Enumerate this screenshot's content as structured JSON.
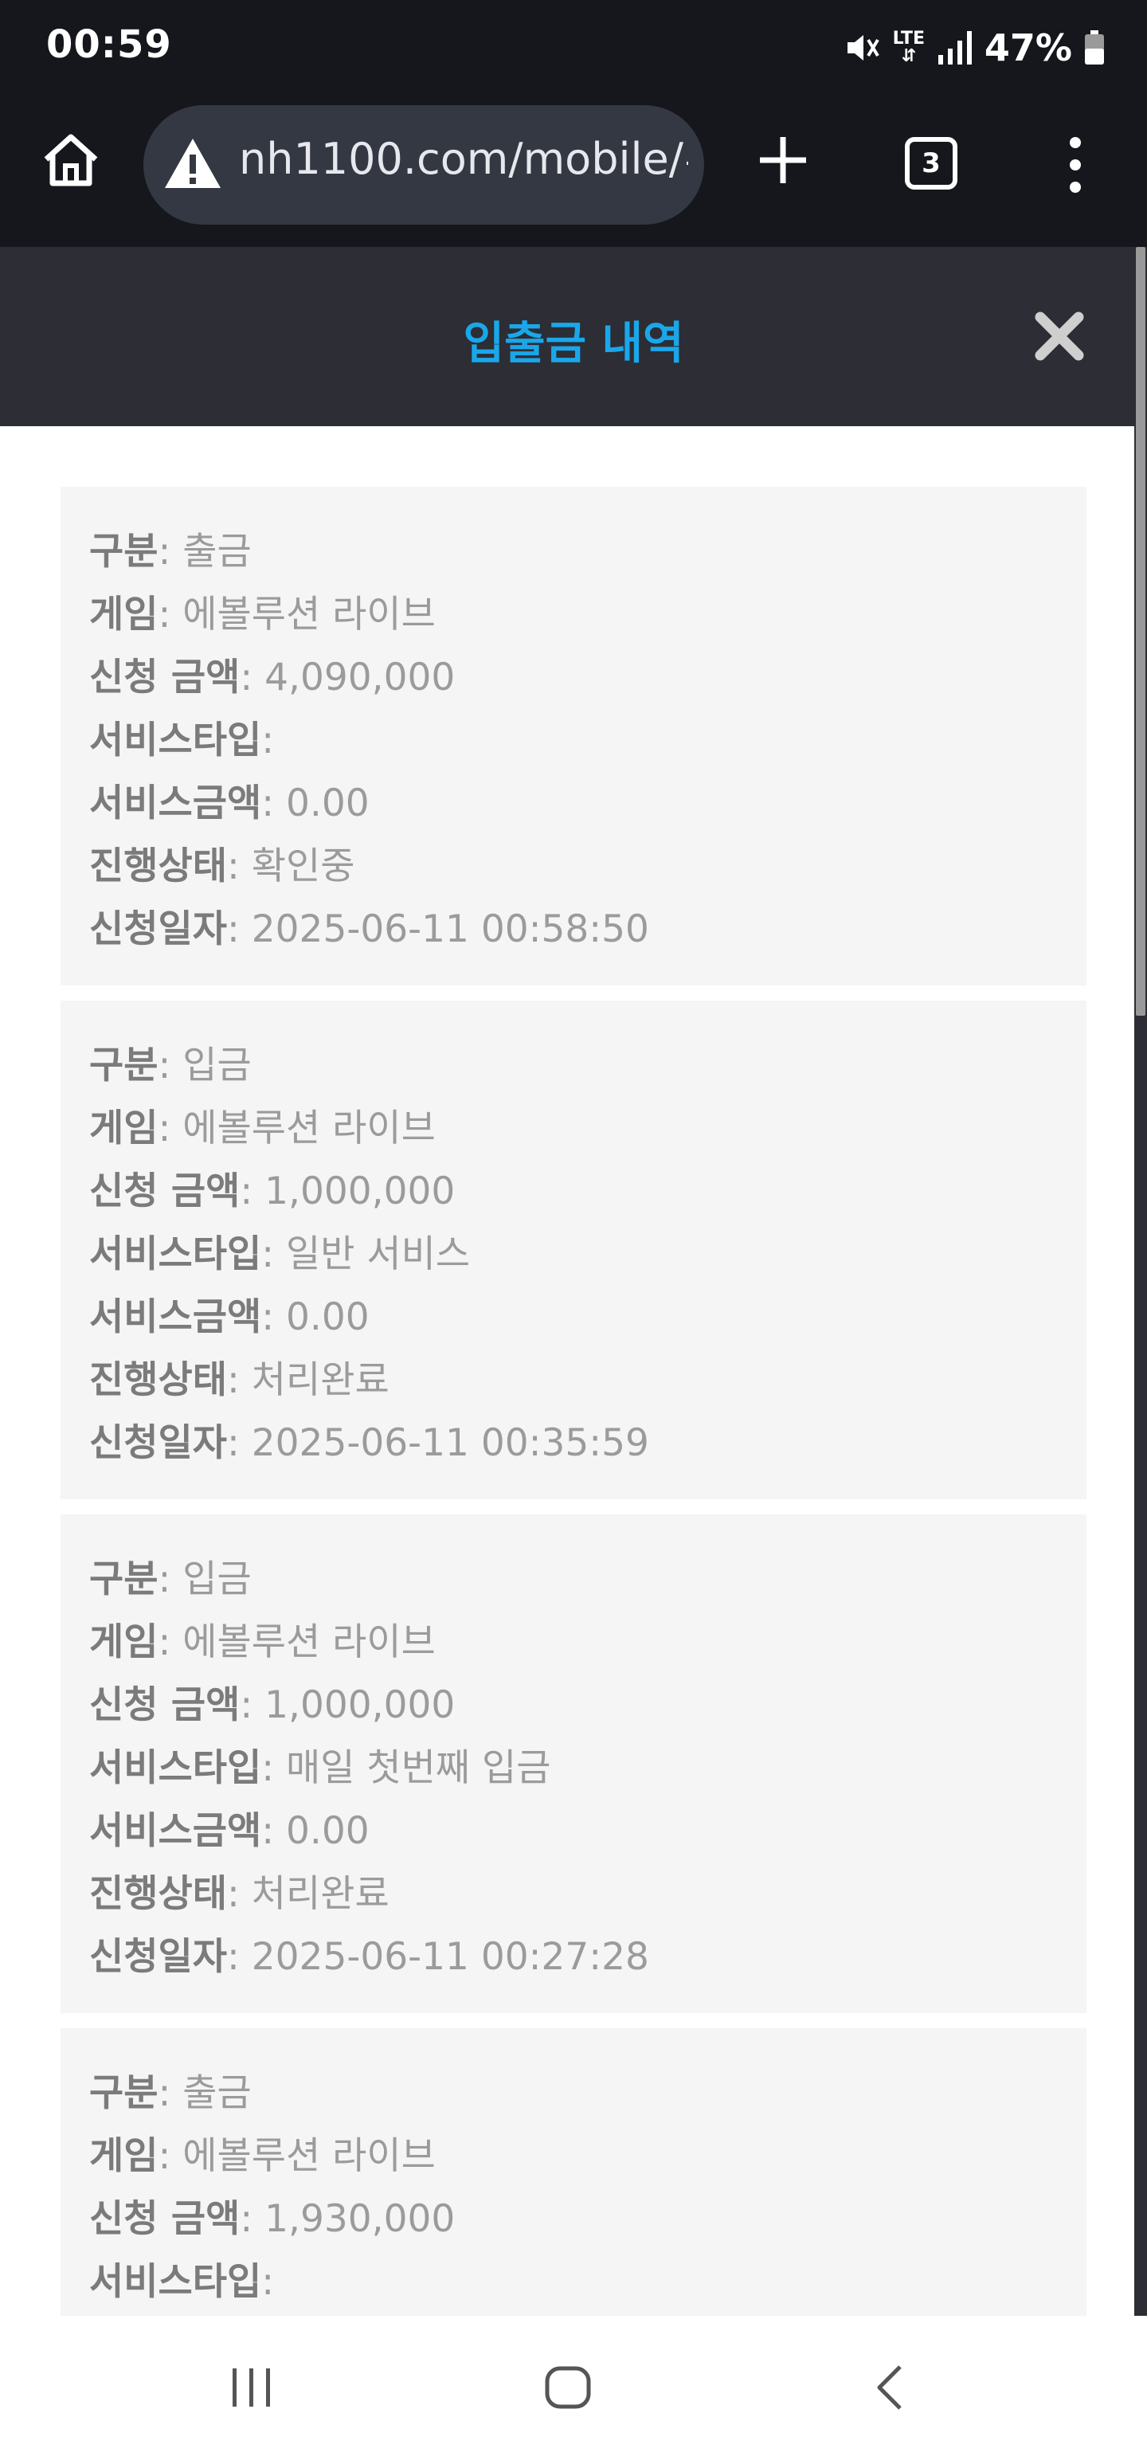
{
  "status_bar": {
    "time": "00:59",
    "network": "LTE",
    "battery": "47%",
    "icons": [
      "mute-icon",
      "lte-icon",
      "signal-icon",
      "battery-icon"
    ]
  },
  "browser": {
    "url": "nh1100.com/mobile/#",
    "tab_count": "3",
    "icons": [
      "home-icon",
      "warning-icon",
      "plus-icon",
      "tabs-icon",
      "more-vert-icon"
    ]
  },
  "page": {
    "title": "입출금 내역",
    "close_icon": "close-icon"
  },
  "labels": {
    "type": "구분",
    "game": "게임",
    "amount": "신청 금액",
    "service_type": "서비스타입",
    "service_amount": "서비스금액",
    "status": "진행상태",
    "date": "신청일자"
  },
  "records": [
    {
      "type": ": 출금",
      "game": ": 에볼루션 라이브",
      "amount": ": 4,090,000",
      "service_type": ":",
      "service_amount": ": 0.00",
      "status": ": 확인중",
      "date": ": 2025-06-11 00:58:50"
    },
    {
      "type": ": 입금",
      "game": ": 에볼루션 라이브",
      "amount": ": 1,000,000",
      "service_type": ": 일반 서비스",
      "service_amount": ": 0.00",
      "status": ": 처리완료",
      "date": ": 2025-06-11 00:35:59"
    },
    {
      "type": ": 입금",
      "game": ": 에볼루션 라이브",
      "amount": ": 1,000,000",
      "service_type": ": 매일 첫번째 입금",
      "service_amount": ": 0.00",
      "status": ": 처리완료",
      "date": ": 2025-06-11 00:27:28"
    },
    {
      "type": ": 출금",
      "game": ": 에볼루션 라이브",
      "amount": ": 1,930,000",
      "service_type": ":"
    }
  ],
  "nav_bar": {
    "icons": [
      "recents-icon",
      "home-circle-icon",
      "back-icon"
    ]
  },
  "colors": {
    "title_accent": "#1aa7ea",
    "header_bg": "#2c2d35",
    "card_bg": "#f5f5f5",
    "label_text": "#7b7b7b",
    "value_text": "#9b9b9b"
  }
}
